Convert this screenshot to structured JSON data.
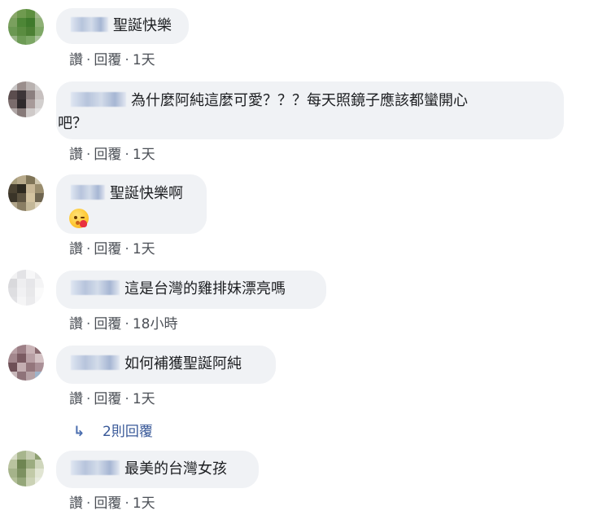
{
  "comments": [
    {
      "text": "聖誕快樂",
      "emoji": "",
      "action_like": "讚",
      "action_reply": "回覆",
      "separator": "·",
      "time": "1天",
      "avatar_colors": [
        "#8aa86a",
        "#6f9a4f",
        "#5d8f3f",
        "#9fb889",
        "#7aa05e",
        "#4d8636",
        "#3f7a2c",
        "#8eb076",
        "#6b9852",
        "#5a8c40",
        "#4c8034",
        "#7ea866",
        "#98b586",
        "#6d9b55",
        "#7ca765",
        "#a9c29a"
      ]
    },
    {
      "text_line1": "為什麼阿純這麼可愛？？？每天照鏡子應該都蠻開心",
      "text_line2": "吧？",
      "action_like": "讚",
      "action_reply": "回覆",
      "separator": "·",
      "time": "1天",
      "avatar_colors": [
        "#c9c6c6",
        "#9a8e8c",
        "#b9b2b0",
        "#d6d4d3",
        "#5b4d4e",
        "#3d3538",
        "#8b7f7f",
        "#c7c0bf",
        "#7a6c6c",
        "#2f2a2c",
        "#a79a99",
        "#d2cfce",
        "#b0a7a6",
        "#867978",
        "#cfcac9",
        "#e1dfdf"
      ]
    },
    {
      "text": "聖誕快樂啊",
      "emoji": "kissing-face-emoji",
      "action_like": "讚",
      "action_reply": "回覆",
      "separator": "·",
      "time": "1天",
      "avatar_colors": [
        "#a59b7a",
        "#b7a98a",
        "#7f7457",
        "#cfc6ad",
        "#4a4232",
        "#2e2a20",
        "#c8b796",
        "#9a8d6e",
        "#3a3428",
        "#5c5340",
        "#d3c3a0",
        "#6e6550",
        "#b1a58a",
        "#8a7e63",
        "#c4b898",
        "#e0d6bf"
      ]
    },
    {
      "text": "這是台灣的雞排妹漂亮嗎",
      "action_like": "讚",
      "action_reply": "回覆",
      "separator": "·",
      "time": "18小時",
      "avatar_colors": [
        "#f2f2f3",
        "#e3e3e6",
        "#f7f7f8",
        "#ececee",
        "#d9d9dc",
        "#eeeeF0",
        "#e6e6e9",
        "#f4f4f5",
        "#dedee1",
        "#f1f1f3",
        "#e8e8ea",
        "#fafafa",
        "#e2e2e5",
        "#f5f5f6",
        "#ebebed",
        "#f8f8f9"
      ]
    },
    {
      "text": "如何補獲聖誕阿純",
      "action_like": "讚",
      "action_reply": "回覆",
      "separator": "·",
      "time": "1天",
      "avatar_colors": [
        "#b79ea3",
        "#9d7f86",
        "#c9b3b6",
        "#8a6a70",
        "#a2868c",
        "#7b5b62",
        "#b89fa4",
        "#d4c2c4",
        "#6e4f56",
        "#c4aeb1",
        "#94767c",
        "#aa9097",
        "#c9b9bb",
        "#8f7379",
        "#b6a1a5",
        "#9fb3c9"
      ]
    },
    {
      "text": "最美的台灣女孩",
      "action_like": "讚",
      "action_reply": "回覆",
      "separator": "·",
      "time": "1天",
      "avatar_colors": [
        "#d7dcc6",
        "#a7b58c",
        "#c5ccb0",
        "#8ea071",
        "#b9c39f",
        "#6f8552",
        "#9cac80",
        "#cfd6bc",
        "#a5b38a",
        "#7d9161",
        "#c2caa8",
        "#e1e5d3",
        "#b3bf98",
        "#94a679",
        "#cbd2b5",
        "#e8ebde"
      ]
    }
  ],
  "replies": {
    "arrow": "↳",
    "label": "2則回覆"
  }
}
